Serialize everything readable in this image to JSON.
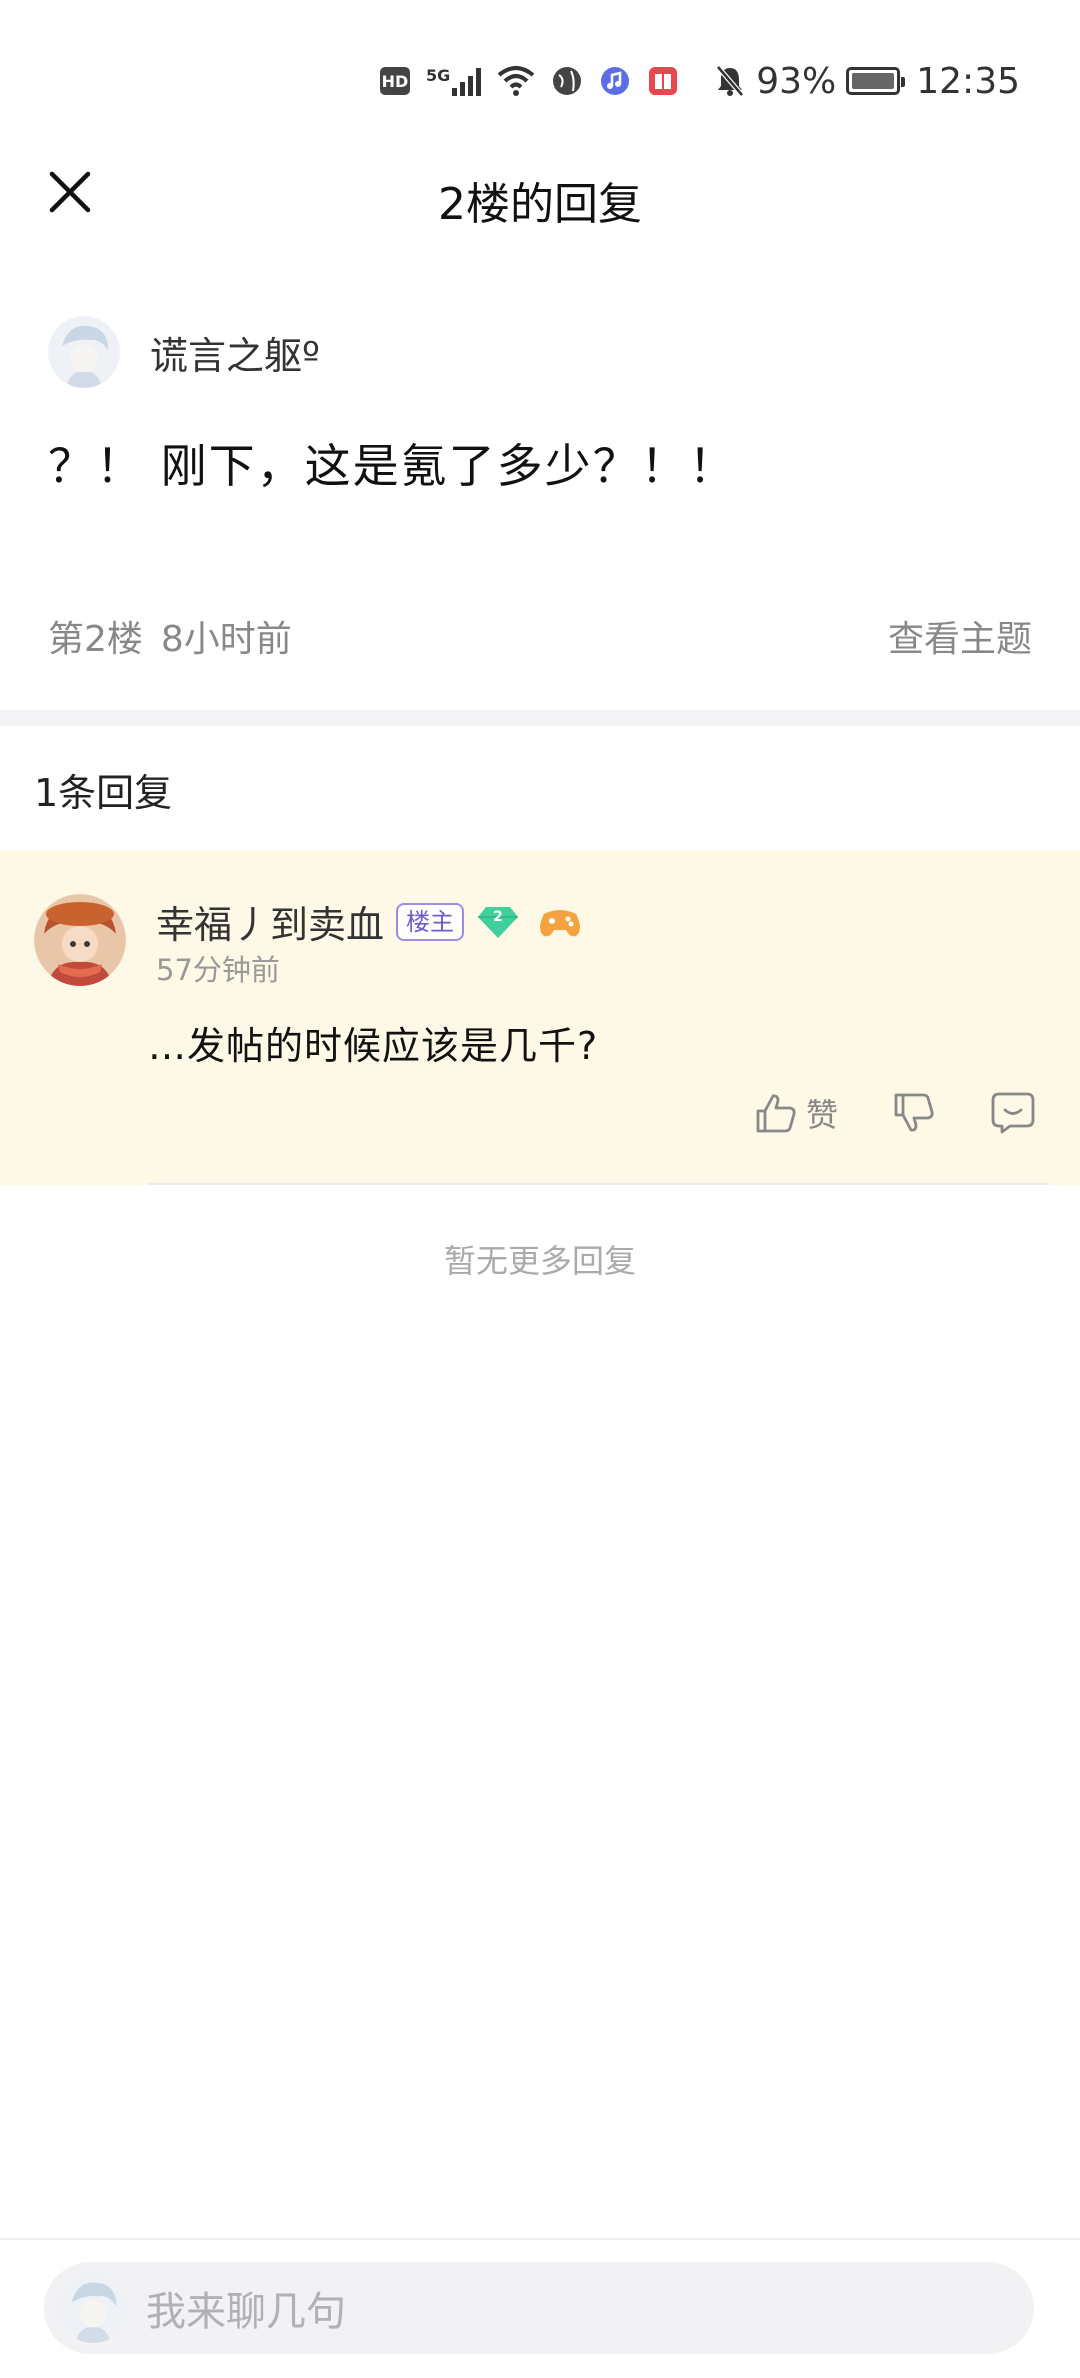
{
  "status_bar": {
    "hd_label": "HD",
    "network": "5G",
    "battery_percent": "93%",
    "time": "12:35"
  },
  "header": {
    "title": "2楼的回复",
    "close_icon": "close-icon"
  },
  "post": {
    "author": "谎言之躯º",
    "content": "？！ 刚下，这是氪了多少？！！",
    "floor": "第2楼",
    "time": "8小时前",
    "view_topic": "查看主题"
  },
  "replies_section": {
    "count_label": "1条回复",
    "no_more_label": "暂无更多回复"
  },
  "reply": {
    "author": "幸福丿到卖血",
    "owner_badge": "楼主",
    "level": "2",
    "time": "57分钟前",
    "content": "…发帖的时候应该是几千?",
    "like_label": "赞"
  },
  "comment_input": {
    "placeholder": "我来聊几句"
  },
  "colors": {
    "reply_bg": "#fdf9e6",
    "owner_badge": "#6e5bd1",
    "level_gem": "#3fcf9a",
    "meta_text": "#888888"
  }
}
